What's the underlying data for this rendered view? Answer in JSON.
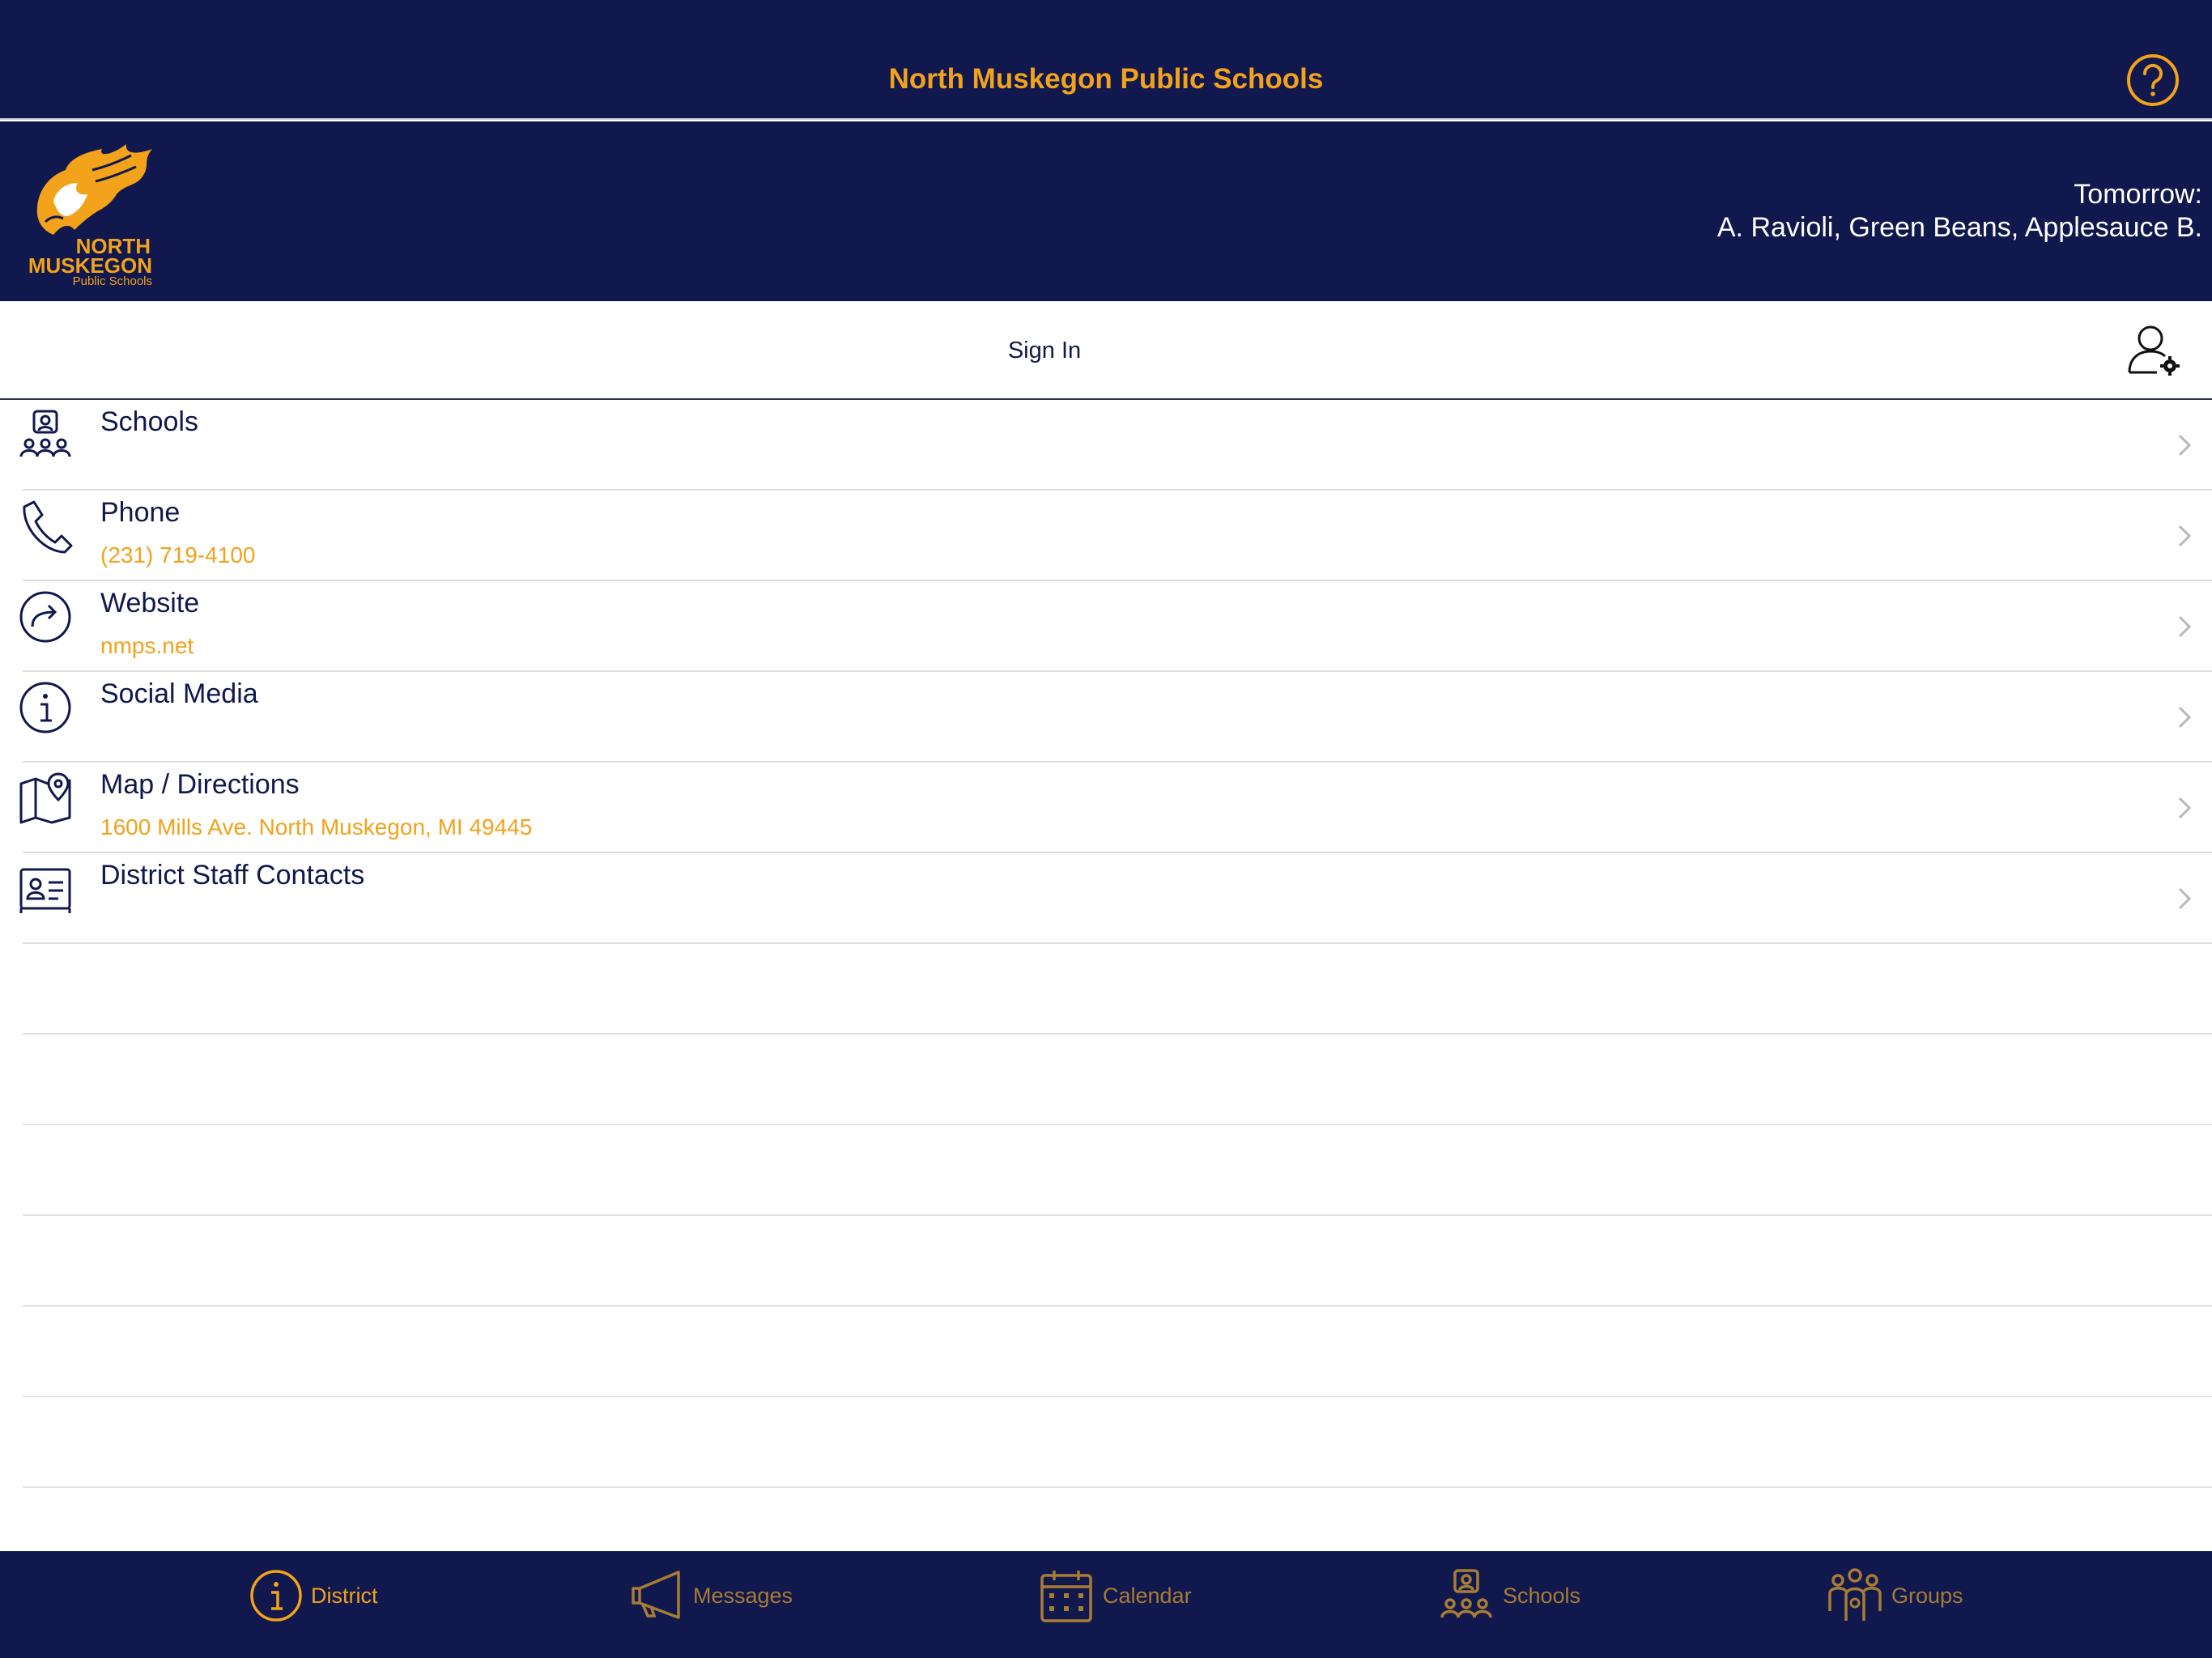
{
  "header": {
    "title": "North Muskegon Public Schools"
  },
  "banner": {
    "logo_line1": "NORTH",
    "logo_line2": "MUSKEGON",
    "logo_line3": "Public Schools",
    "menu_line1": "Tomorrow:",
    "menu_line2": "A. Ravioli, Green Beans, Applesauce  B."
  },
  "signin": {
    "label": "Sign In"
  },
  "list": {
    "items": [
      {
        "label": "Schools",
        "sub": "",
        "icon": "schools-icon"
      },
      {
        "label": "Phone",
        "sub": "(231) 719-4100",
        "icon": "phone-icon"
      },
      {
        "label": "Website",
        "sub": "nmps.net",
        "icon": "website-icon"
      },
      {
        "label": "Social Media",
        "sub": "",
        "icon": "info-icon"
      },
      {
        "label": "Map / Directions",
        "sub": "1600 Mills Ave. North Muskegon, MI 49445",
        "icon": "map-icon"
      },
      {
        "label": "District Staff Contacts",
        "sub": "",
        "icon": "contact-card-icon"
      }
    ]
  },
  "tabs": [
    {
      "label": "District",
      "icon": "info-icon",
      "active": true
    },
    {
      "label": "Messages",
      "icon": "megaphone-icon",
      "active": false
    },
    {
      "label": "Calendar",
      "icon": "calendar-icon",
      "active": false
    },
    {
      "label": "Schools",
      "icon": "schools-icon",
      "active": false
    },
    {
      "label": "Groups",
      "icon": "groups-icon",
      "active": false
    }
  ],
  "colors": {
    "navy": "#10184d",
    "gold": "#f2a21b",
    "gold_muted": "#a77c34"
  }
}
